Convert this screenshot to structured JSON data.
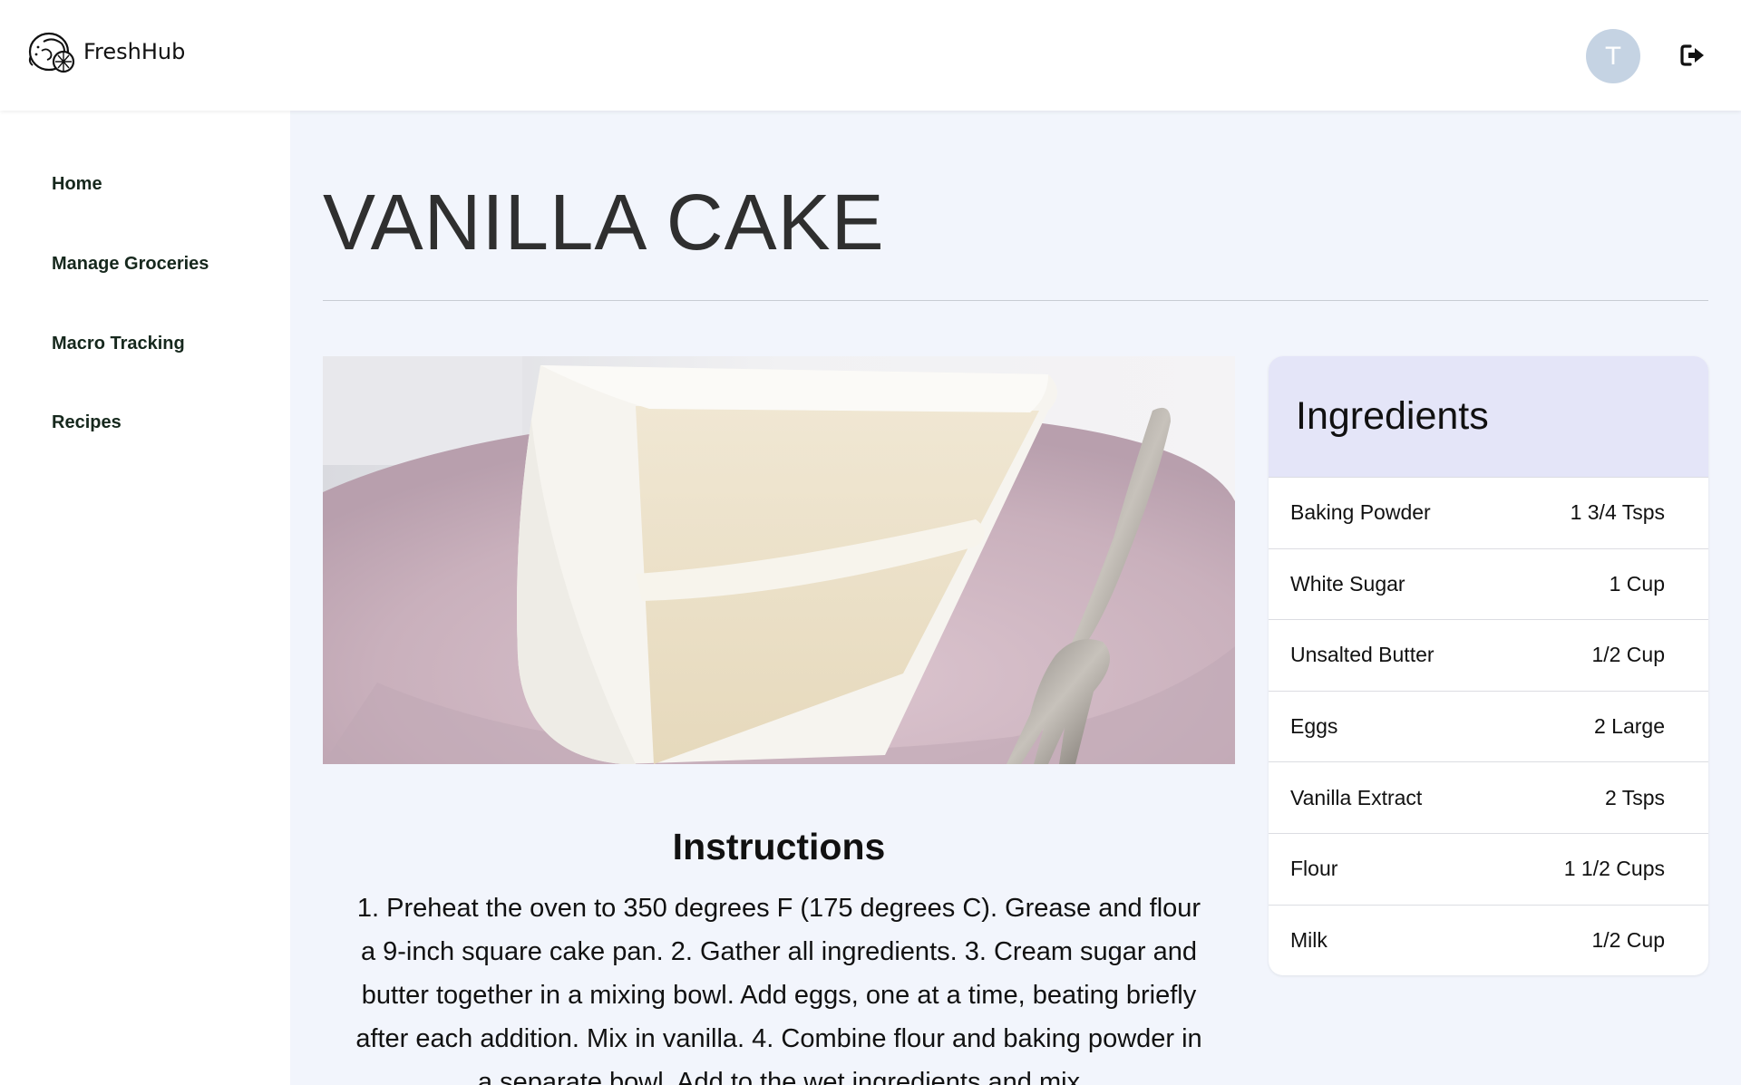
{
  "header": {
    "brand": "FreshHub",
    "logo_icon": "lemon-logo-icon",
    "avatar_initial": "T",
    "avatar_color": "#c5d3e3",
    "logout_icon": "logout-icon"
  },
  "sidebar": {
    "items": [
      {
        "label": "Home"
      },
      {
        "label": "Manage Groceries"
      },
      {
        "label": "Macro Tracking"
      },
      {
        "label": "Recipes"
      }
    ]
  },
  "recipe": {
    "title": "VANILLA CAKE",
    "image": "vanilla-cake-slice-photo",
    "instructions_title": "Instructions",
    "instructions": "1. Preheat the oven to 350 degrees F (175 degrees C). Grease and flour a 9-inch square cake pan. 2. Gather all ingredients. 3. Cream sugar and butter together in a mixing bowl. Add eggs, one at a time, beating briefly after each addition. Mix in vanilla. 4. Combine flour and baking powder in a separate bowl. Add to the wet ingredients and mix"
  },
  "ingredients": {
    "title": "Ingredients",
    "header_color": "#e4e5f8",
    "items": [
      {
        "name": "Baking Powder",
        "amount": "1 3/4 Tsps"
      },
      {
        "name": "White Sugar",
        "amount": "1 Cup"
      },
      {
        "name": "Unsalted Butter",
        "amount": "1/2 Cup"
      },
      {
        "name": "Eggs",
        "amount": "2 Large"
      },
      {
        "name": "Vanilla Extract",
        "amount": "2 Tsps"
      },
      {
        "name": "Flour",
        "amount": "1 1/2 Cups"
      },
      {
        "name": "Milk",
        "amount": "1/2 Cup"
      }
    ]
  }
}
